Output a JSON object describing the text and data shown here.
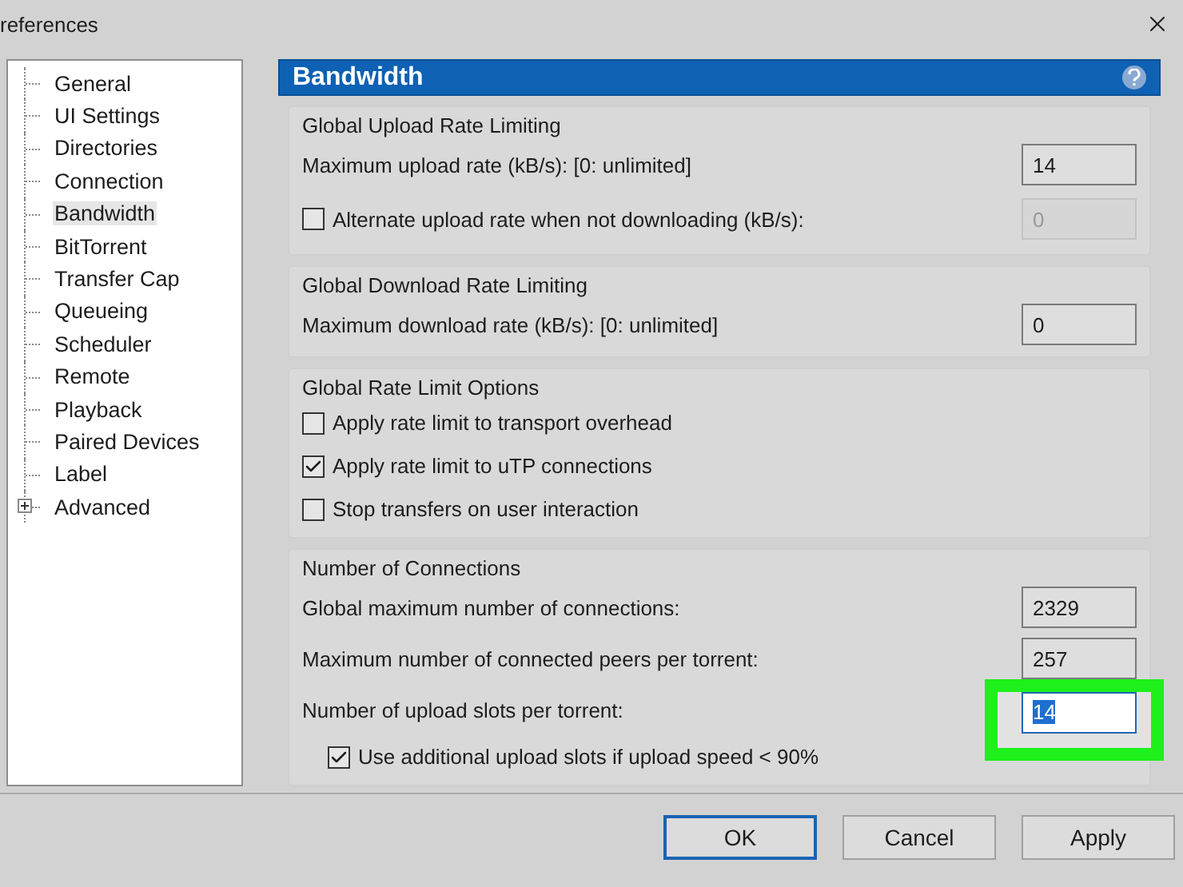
{
  "window": {
    "title": "references"
  },
  "sidebar": {
    "items": [
      {
        "label": "General",
        "selected": false,
        "kind": "leaf"
      },
      {
        "label": "UI Settings",
        "selected": false,
        "kind": "leaf"
      },
      {
        "label": "Directories",
        "selected": false,
        "kind": "leaf"
      },
      {
        "label": "Connection",
        "selected": false,
        "kind": "leaf"
      },
      {
        "label": "Bandwidth",
        "selected": true,
        "kind": "leaf"
      },
      {
        "label": "BitTorrent",
        "selected": false,
        "kind": "leaf"
      },
      {
        "label": "Transfer Cap",
        "selected": false,
        "kind": "leaf"
      },
      {
        "label": "Queueing",
        "selected": false,
        "kind": "leaf"
      },
      {
        "label": "Scheduler",
        "selected": false,
        "kind": "leaf"
      },
      {
        "label": "Remote",
        "selected": false,
        "kind": "leaf"
      },
      {
        "label": "Playback",
        "selected": false,
        "kind": "leaf"
      },
      {
        "label": "Paired Devices",
        "selected": false,
        "kind": "leaf"
      },
      {
        "label": "Label",
        "selected": false,
        "kind": "leaf"
      },
      {
        "label": "Advanced",
        "selected": false,
        "kind": "folder"
      }
    ]
  },
  "panel": {
    "title": "Bandwidth",
    "groups": [
      {
        "title": "Global Upload Rate Limiting",
        "rows": [
          {
            "kind": "field",
            "label": "Maximum upload rate (kB/s): [0: unlimited]",
            "value": "14",
            "disabled": false,
            "text_selected": false,
            "highlighted": false
          },
          {
            "kind": "checkbox-field",
            "label": "Alternate upload rate when not downloading (kB/s):",
            "checked": false,
            "value": "0",
            "disabled": true,
            "text_selected": false,
            "highlighted": false
          }
        ]
      },
      {
        "title": "Global Download Rate Limiting",
        "rows": [
          {
            "kind": "field",
            "label": "Maximum download rate (kB/s): [0: unlimited]",
            "value": "0",
            "disabled": false,
            "text_selected": false,
            "highlighted": false
          }
        ]
      },
      {
        "title": "Global Rate Limit Options",
        "rows": [
          {
            "kind": "checkbox",
            "label": "Apply rate limit to transport overhead",
            "checked": false
          },
          {
            "kind": "checkbox",
            "label": "Apply rate limit to uTP connections",
            "checked": true
          },
          {
            "kind": "checkbox",
            "label": "Stop transfers on user interaction",
            "checked": false
          }
        ]
      },
      {
        "title": "Number of Connections",
        "rows": [
          {
            "kind": "field",
            "label": "Global maximum number of connections:",
            "value": "2329",
            "disabled": false,
            "text_selected": false,
            "highlighted": false
          },
          {
            "kind": "field",
            "label": "Maximum number of connected peers per torrent:",
            "value": "257",
            "disabled": false,
            "text_selected": false,
            "highlighted": false
          },
          {
            "kind": "field",
            "label": "Number of upload slots per torrent:",
            "value": "14",
            "disabled": false,
            "text_selected": true,
            "highlighted": true
          },
          {
            "kind": "sub-checkbox",
            "label": "Use additional upload slots if upload speed < 90%",
            "checked": true
          }
        ]
      }
    ]
  },
  "buttons": [
    {
      "label": "OK",
      "default": true
    },
    {
      "label": "Cancel",
      "default": false
    },
    {
      "label": "Apply",
      "default": false
    }
  ]
}
